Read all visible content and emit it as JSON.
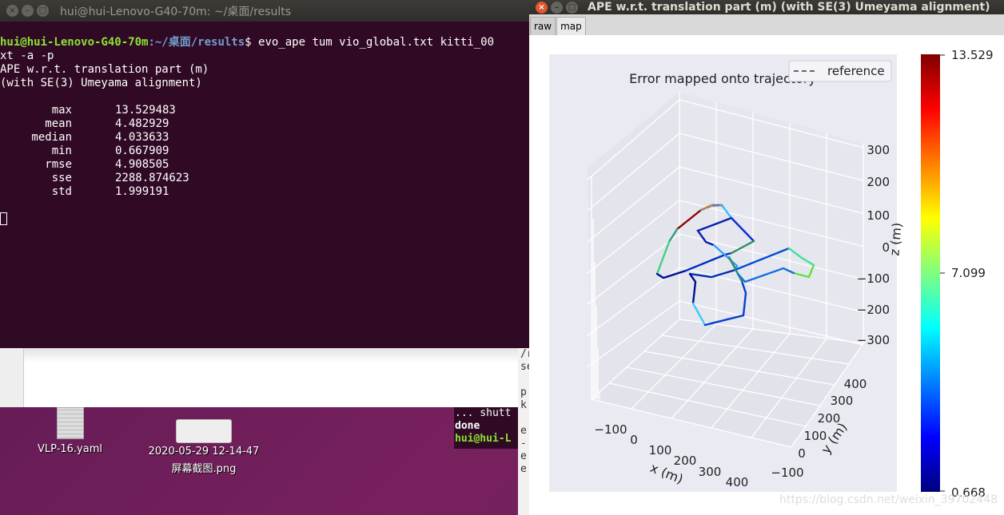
{
  "terminal": {
    "title": "hui@hui-Lenovo-G40-70m: ~/桌面/results",
    "prompt_user": "hui@hui-Lenovo-G40-70m",
    "prompt_path": ":~/桌面/results",
    "command": "$ evo_ape tum vio_global.txt kitti_00",
    "command_wrap": "xt -a -p",
    "output_line1": "APE w.r.t. translation part (m)",
    "output_line2": "(with SE(3) Umeyama alignment)",
    "stats": [
      {
        "name": "max",
        "value": "13.529483"
      },
      {
        "name": "mean",
        "value": "4.482929"
      },
      {
        "name": "median",
        "value": "4.033633"
      },
      {
        "name": "min",
        "value": "0.667909"
      },
      {
        "name": "rmse",
        "value": "4.908505"
      },
      {
        "name": "sse",
        "value": "2288.874623"
      },
      {
        "name": "std",
        "value": "1.999191"
      }
    ]
  },
  "desktop": {
    "icons": [
      {
        "label": "VLP-16.yaml"
      },
      {
        "label": "2020-05-29 12-14-47",
        "label2": "屏幕截图.png"
      }
    ]
  },
  "mini_terminal": {
    "lines": [
      "... shutt",
      "done",
      "hui@hui-L"
    ]
  },
  "strip_lines": [
    "/r",
    "se",
    "",
    "p",
    "k",
    "",
    "e",
    "-",
    "e",
    "e"
  ],
  "plot_window": {
    "title": "APE w.r.t. translation part (m) (with SE(3) Umeyama alignment)",
    "tabs": [
      {
        "label": "raw",
        "active": false
      },
      {
        "label": "map",
        "active": true
      }
    ]
  },
  "plot": {
    "title": "Error mapped onto trajectory",
    "legend": "reference",
    "xlabel": "x (m)",
    "ylabel": "y (m)",
    "zlabel": "z (m)",
    "x_ticks": [
      "−100",
      "0",
      "100",
      "200",
      "300",
      "400"
    ],
    "y_ticks": [
      "400",
      "300",
      "200",
      "100",
      "0",
      "−100"
    ],
    "z_ticks": [
      "300",
      "200",
      "100",
      "0",
      "−100",
      "−200",
      "−300"
    ],
    "colorbar": {
      "max": "13.529",
      "mid": "7.099",
      "min": "0.668",
      "colormap": "jet"
    }
  },
  "watermark": "https://blog.csdn.net/weixin_39702448"
}
